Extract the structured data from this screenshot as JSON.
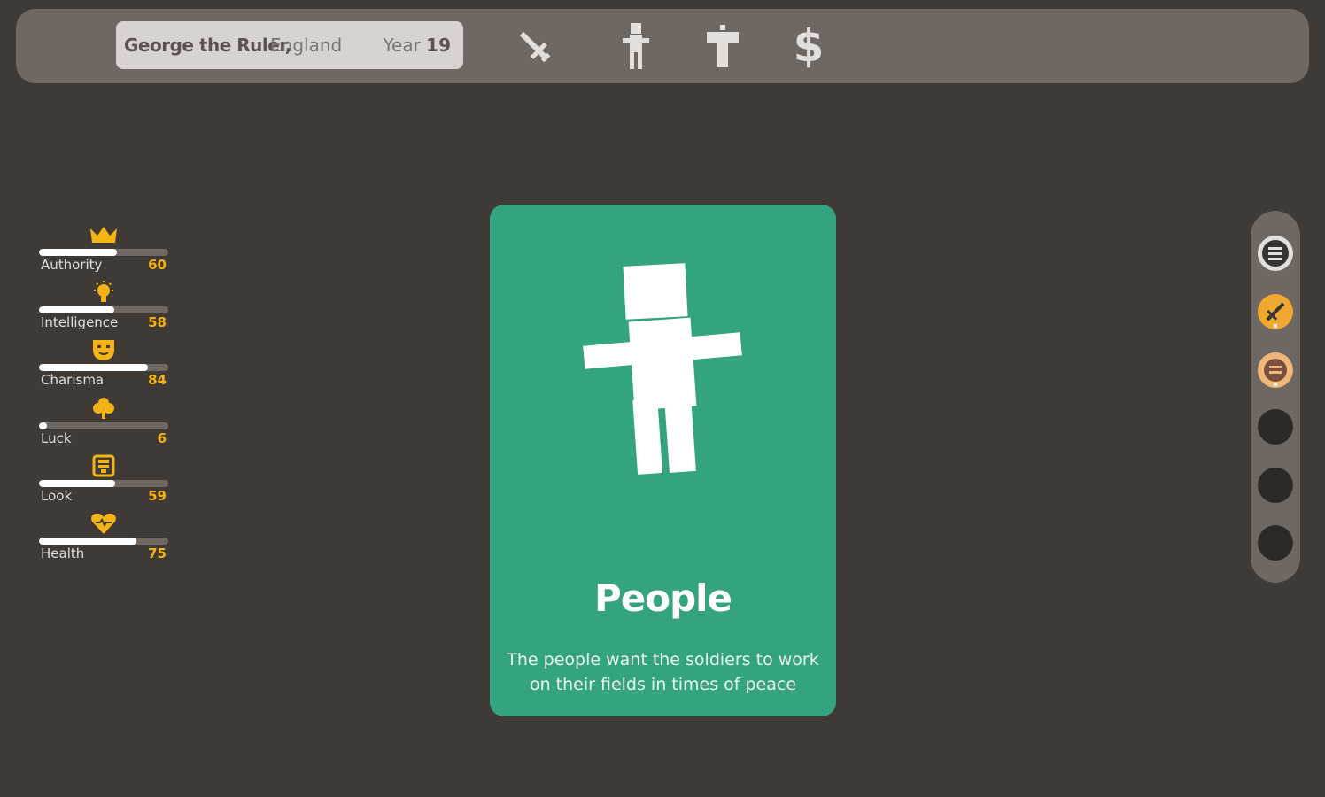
{
  "header": {
    "ruler_name": "George the Ruler,",
    "country": "England",
    "year_label": "Year",
    "year_value": "19",
    "factions": [
      {
        "icon": "sword-icon"
      },
      {
        "icon": "person-icon"
      },
      {
        "icon": "cross-icon"
      },
      {
        "icon": "dollar-icon",
        "glyph": "$"
      }
    ]
  },
  "stats": [
    {
      "label": "Authority",
      "value": "60",
      "icon": "crown-icon",
      "level": 60
    },
    {
      "label": "Intelligence",
      "value": "58",
      "icon": "lightbulb-icon",
      "level": 58
    },
    {
      "label": "Charisma",
      "value": "84",
      "icon": "mask-icon",
      "level": 84
    },
    {
      "label": "Luck",
      "value": "6",
      "icon": "clover-icon",
      "level": 6
    },
    {
      "label": "Look",
      "value": "59",
      "icon": "mirror-icon",
      "level": 59
    },
    {
      "label": "Health",
      "value": "75",
      "icon": "heart-icon",
      "level": 75
    }
  ],
  "card": {
    "title": "People",
    "text": "The people want the soldiers to work on their fields in times of peace",
    "icon": "person-figure-icon",
    "color": "#34a37f"
  },
  "sidebar": {
    "buttons": [
      {
        "icon": "menu-icon"
      },
      {
        "icon": "sword-badge-icon"
      },
      {
        "icon": "scroll-badge-icon"
      },
      {
        "icon": "empty-slot"
      },
      {
        "icon": "empty-slot"
      },
      {
        "icon": "empty-slot"
      }
    ]
  },
  "colors": {
    "background": "#403a36",
    "panel": "#6f6762",
    "accent": "#f5b413",
    "card": "#34a37f"
  }
}
